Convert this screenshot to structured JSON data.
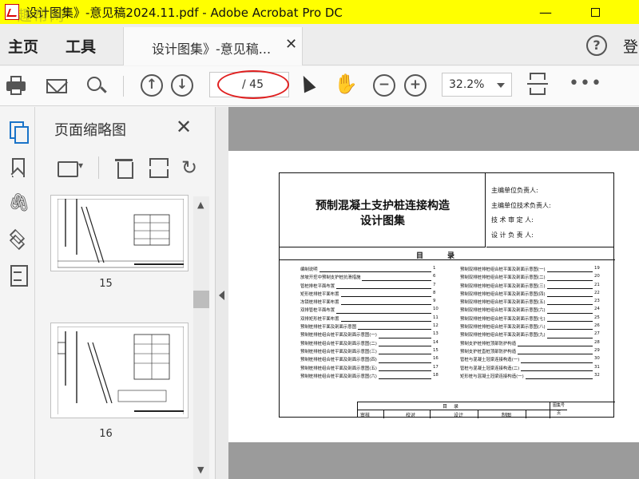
{
  "window": {
    "title": "设计图集》-意见稿2024.11.pdf - Adobe Acrobat Pro DC",
    "minimize": "—",
    "watermark": "趣帮网"
  },
  "menu": {
    "home": "主页",
    "tools": "工具",
    "login": "登"
  },
  "tab": {
    "label": "设计图集》-意见稿...",
    "close": "✕"
  },
  "toolbar": {
    "current_page": "",
    "total_pages": "/ 45",
    "zoom": "32.2%",
    "up_icon": "↑",
    "down_icon": "↓",
    "zoom_out_icon": "−",
    "zoom_in_icon": "+",
    "more_icon": "•••",
    "hand_icon": "✋",
    "help_icon": "?"
  },
  "panel": {
    "title": "页面缩略图",
    "close": "✕",
    "rotate_icon": "↻",
    "thumbnails": [
      {
        "label": "15"
      },
      {
        "label": "16"
      }
    ],
    "scroll_up": "▲",
    "scroll_down": "▼"
  },
  "rail": {
    "clip_icon": "🖇"
  },
  "document": {
    "title_line1": "预制混凝土支护桩连接构造",
    "title_line2": "设计图集",
    "responsible": [
      "主编单位负责人:",
      "主编单位技术负责人:",
      "技 术 审 定 人:",
      "设 计 负 责 人:"
    ],
    "toc_heading": "目录",
    "toc_left": [
      {
        "text": "编制说明",
        "page": "1"
      },
      {
        "text": "放坡开挖中预制支护桩抗滑措施",
        "page": "6"
      },
      {
        "text": "管桩排桩平面布置",
        "page": "7"
      },
      {
        "text": "矩形桩排桩平面布置",
        "page": "8"
      },
      {
        "text": "冻锁桩排桩平面布置",
        "page": "9"
      },
      {
        "text": "双排管桩平面布置",
        "page": "10"
      },
      {
        "text": "双排矩形桩平面布置",
        "page": "11"
      },
      {
        "text": "预制桩排桩平面及剖面示意图",
        "page": "12"
      },
      {
        "text": "预制桩排桩组合桩平面及剖面示意图(一)",
        "page": "13"
      },
      {
        "text": "预制桩排桩组合桩平面及剖面示意图(二)",
        "page": "14"
      },
      {
        "text": "预制桩排桩组合桩平面及剖面示意图(三)",
        "page": "15"
      },
      {
        "text": "预制桩排桩组合桩平面及剖面示意图(四)",
        "page": "16"
      },
      {
        "text": "预制桩排桩组合桩平面及剖面示意图(五)",
        "page": "17"
      },
      {
        "text": "预制桩排桩组合桩平面及剖面示意图(六)",
        "page": "18"
      }
    ],
    "toc_right": [
      {
        "text": "预制双排桩排桩组合桩平面及剖面示意图(一)",
        "page": "19"
      },
      {
        "text": "预制双排桩排桩组合桩平面及剖面示意图(二)",
        "page": "20"
      },
      {
        "text": "预制双排桩排桩组合桩平面及剖面示意图(三)",
        "page": "21"
      },
      {
        "text": "预制双排桩排桩组合桩平面及剖面示意图(四)",
        "page": "22"
      },
      {
        "text": "预制双排桩排桩组合桩平面及剖面示意图(五)",
        "page": "23"
      },
      {
        "text": "预制双排桩排桩组合桩平面及剖面示意图(六)",
        "page": "24"
      },
      {
        "text": "预制双排桩排桩组合桩平面及剖面示意图(七)",
        "page": "25"
      },
      {
        "text": "预制双排桩排桩组合桩平面及剖面示意图(八)",
        "page": "26"
      },
      {
        "text": "预制双排桩排桩组合桩平面及剖面示意图(九)",
        "page": "27"
      },
      {
        "text": "预制支护桩排桩顶部防护构造",
        "page": "28"
      },
      {
        "text": "预制支护桩直桩顶部防护构造",
        "page": "29"
      },
      {
        "text": "管桩与混凝土冠梁连接构造(一)",
        "page": "30"
      },
      {
        "text": "管桩与混凝土冠梁连接构造(二)",
        "page": "31"
      },
      {
        "text": "矩形桩与混凝土冠梁连接构造(一)",
        "page": "32"
      }
    ],
    "title_block": {
      "name": "目录",
      "code_label": "图集号",
      "code_value": "页",
      "cells": [
        "审核",
        "校对",
        "设计",
        "制图"
      ]
    }
  }
}
